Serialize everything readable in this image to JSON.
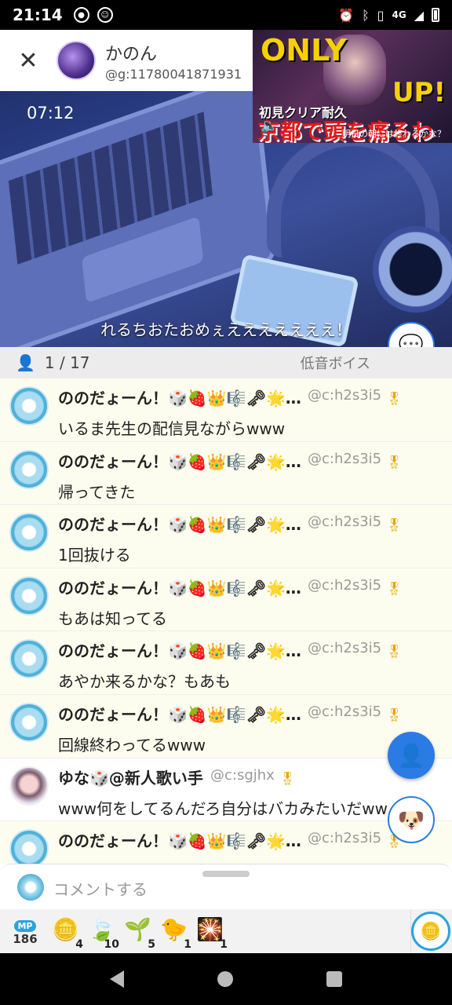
{
  "status_bar": {
    "time": "21:14",
    "network": "4G",
    "icons": [
      "notification-icon",
      "android-icon",
      "alarm-icon",
      "bluetooth-icon",
      "vibrate-icon",
      "signal-icon",
      "battery-icon"
    ]
  },
  "header": {
    "host_name": "かのん",
    "host_id": "@g:11780041871931"
  },
  "video": {
    "timer": "07:12",
    "caption": "れるちおたおめぇえええええええ！",
    "thumbnail": {
      "top_text": "ONLY",
      "right_text": "UP!",
      "title": "初見クリア耐久",
      "big_text": "京都で頭を痛るわ",
      "sub": "明日の朝には終わるかな？"
    }
  },
  "listener_bar": {
    "count": "1 / 17",
    "genre": "低音ボイス"
  },
  "comments": [
    {
      "name": "ののだょーん！🎲🍓👑🎼🗝🌟…",
      "id": "@c:h2s3i5",
      "text": "いるま先生の配信見ながらwww",
      "avatar": "blue"
    },
    {
      "name": "ののだょーん！🎲🍓👑🎼🗝🌟…",
      "id": "@c:h2s3i5",
      "text": "帰ってきた",
      "avatar": "blue"
    },
    {
      "name": "ののだょーん！🎲🍓👑🎼🗝🌟…",
      "id": "@c:h2s3i5",
      "text": "1回抜ける",
      "avatar": "blue"
    },
    {
      "name": "ののだょーん！🎲🍓👑🎼🗝🌟…",
      "id": "@c:h2s3i5",
      "text": "もあは知ってる",
      "avatar": "blue"
    },
    {
      "name": "ののだょーん！🎲🍓👑🎼🗝🌟…",
      "id": "@c:h2s3i5",
      "text": "あやか来るかな？もあも",
      "avatar": "blue"
    },
    {
      "name": "ののだょーん！🎲🍓👑🎼🗝🌟…",
      "id": "@c:h2s3i5",
      "text": "回線終わってるwww",
      "avatar": "blue"
    },
    {
      "name": "ゆな🎲@新人歌い手",
      "id": "@c:sgjhx",
      "text": "www何をしてるんだろ自分はバカみたいだww",
      "avatar": "girl"
    },
    {
      "name": "ののだょーん！🎲🍓👑🎼🗝🌟…",
      "id": "@c:h2s3i5",
      "text": "",
      "avatar": "blue"
    }
  ],
  "input": {
    "placeholder": "コメントする"
  },
  "items": {
    "mp_label": "MP",
    "mp_value": "186",
    "list": [
      {
        "icon": "coin-icon",
        "glyph": "🪙",
        "count": "4"
      },
      {
        "icon": "leaf-card-icon",
        "glyph": "🍃",
        "count": "10"
      },
      {
        "icon": "sprout-card-icon",
        "glyph": "🌱",
        "count": "5"
      },
      {
        "icon": "chick-icon",
        "glyph": "🐤",
        "count": "1"
      },
      {
        "icon": "firework-icon",
        "glyph": "🎇",
        "count": "1"
      }
    ]
  },
  "colors": {
    "accent": "#2a7be4",
    "comment_bg": "#fdfdef",
    "listener_bar_bg": "#ececec"
  }
}
